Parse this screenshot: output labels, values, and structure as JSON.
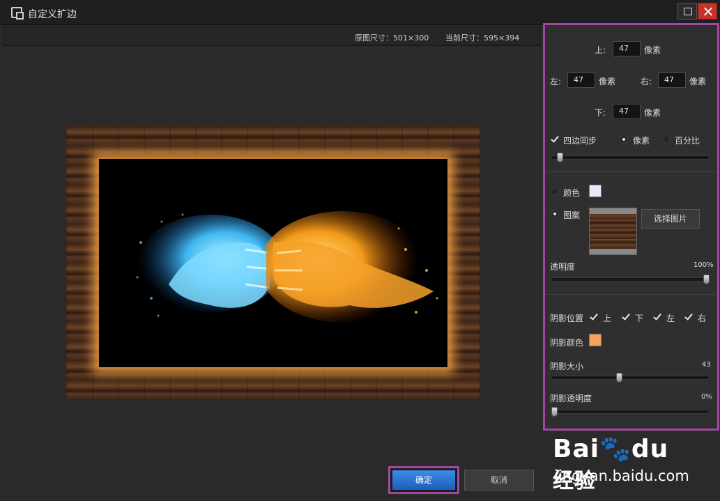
{
  "window": {
    "title": "自定义扩边"
  },
  "info": {
    "original_size": "原图尺寸：501×300",
    "current_size": "当前尺寸：595×394"
  },
  "margins": {
    "top_label": "上:",
    "top_value": "47",
    "left_label": "左:",
    "left_value": "47",
    "right_label": "右:",
    "right_value": "47",
    "bottom_label": "下:",
    "bottom_value": "47",
    "unit": "像素"
  },
  "sync": {
    "label": "四边同步",
    "checked": true
  },
  "unit_mode": {
    "pixel_label": "像素",
    "percent_label": "百分比",
    "selected": "像素"
  },
  "border_slider": {
    "level": 0.05
  },
  "fill": {
    "color_label": "颜色",
    "color_value": "#e8e8f8",
    "pattern_label": "图案",
    "selected": "图案",
    "choose_image_label": "选择图片"
  },
  "opacity": {
    "label": "透明度",
    "value": "100%",
    "level": 1.0
  },
  "shadow": {
    "position_label": "阴影位置",
    "sides": [
      {
        "label": "上",
        "checked": true
      },
      {
        "label": "下",
        "checked": true
      },
      {
        "label": "左",
        "checked": true
      },
      {
        "label": "右",
        "checked": true
      }
    ],
    "color_label": "阴影颜色",
    "color_value": "#f5a55a",
    "size_label": "阴影大小",
    "size_value": "43",
    "size_level": 0.43,
    "opacity_label": "阴影透明度",
    "opacity_value": "0%",
    "opacity_level": 0.0
  },
  "buttons": {
    "ok": "确定",
    "cancel": "取消"
  },
  "watermark": {
    "logo_en": "Bai",
    "logo_du": "du",
    "logo_cn": "经验",
    "url": "jingyan.baidu.com"
  },
  "colors": {
    "panel_highlight": "#a347a6",
    "ok_button": "#2f7cd8"
  }
}
